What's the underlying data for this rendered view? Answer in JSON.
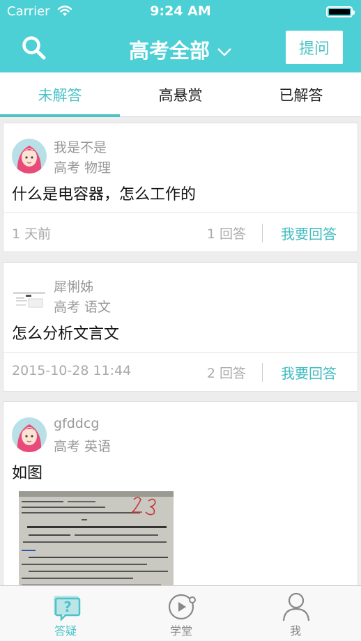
{
  "status_bar": {
    "carrier": "Carrier",
    "time": "9:24 AM"
  },
  "nav": {
    "title": "高考全部",
    "ask_label": "提问"
  },
  "tabs": [
    {
      "label": "未解答"
    },
    {
      "label": "高悬赏"
    },
    {
      "label": "已解答"
    }
  ],
  "questions": [
    {
      "username": "我是不是",
      "meta": "高考 物理",
      "text": "什么是电容器，怎么工作的",
      "time": "1 天前",
      "answers": "1 回答",
      "answer_action": "我要回答"
    },
    {
      "username": "犀悧姊",
      "meta": "高考 语文",
      "text": "怎么分析文言文",
      "time": "2015-10-28 11:44",
      "answers": "2 回答",
      "answer_action": "我要回答"
    },
    {
      "username": "gfddcg",
      "meta": "高考 英语",
      "text": "如图"
    }
  ],
  "bottom_tabs": [
    {
      "label": "答疑",
      "icon": "qa-icon"
    },
    {
      "label": "学堂",
      "icon": "play-icon"
    },
    {
      "label": "我",
      "icon": "person-icon"
    }
  ],
  "colors": {
    "accent": "#4dc3c8",
    "header": "#4dd0d5"
  }
}
